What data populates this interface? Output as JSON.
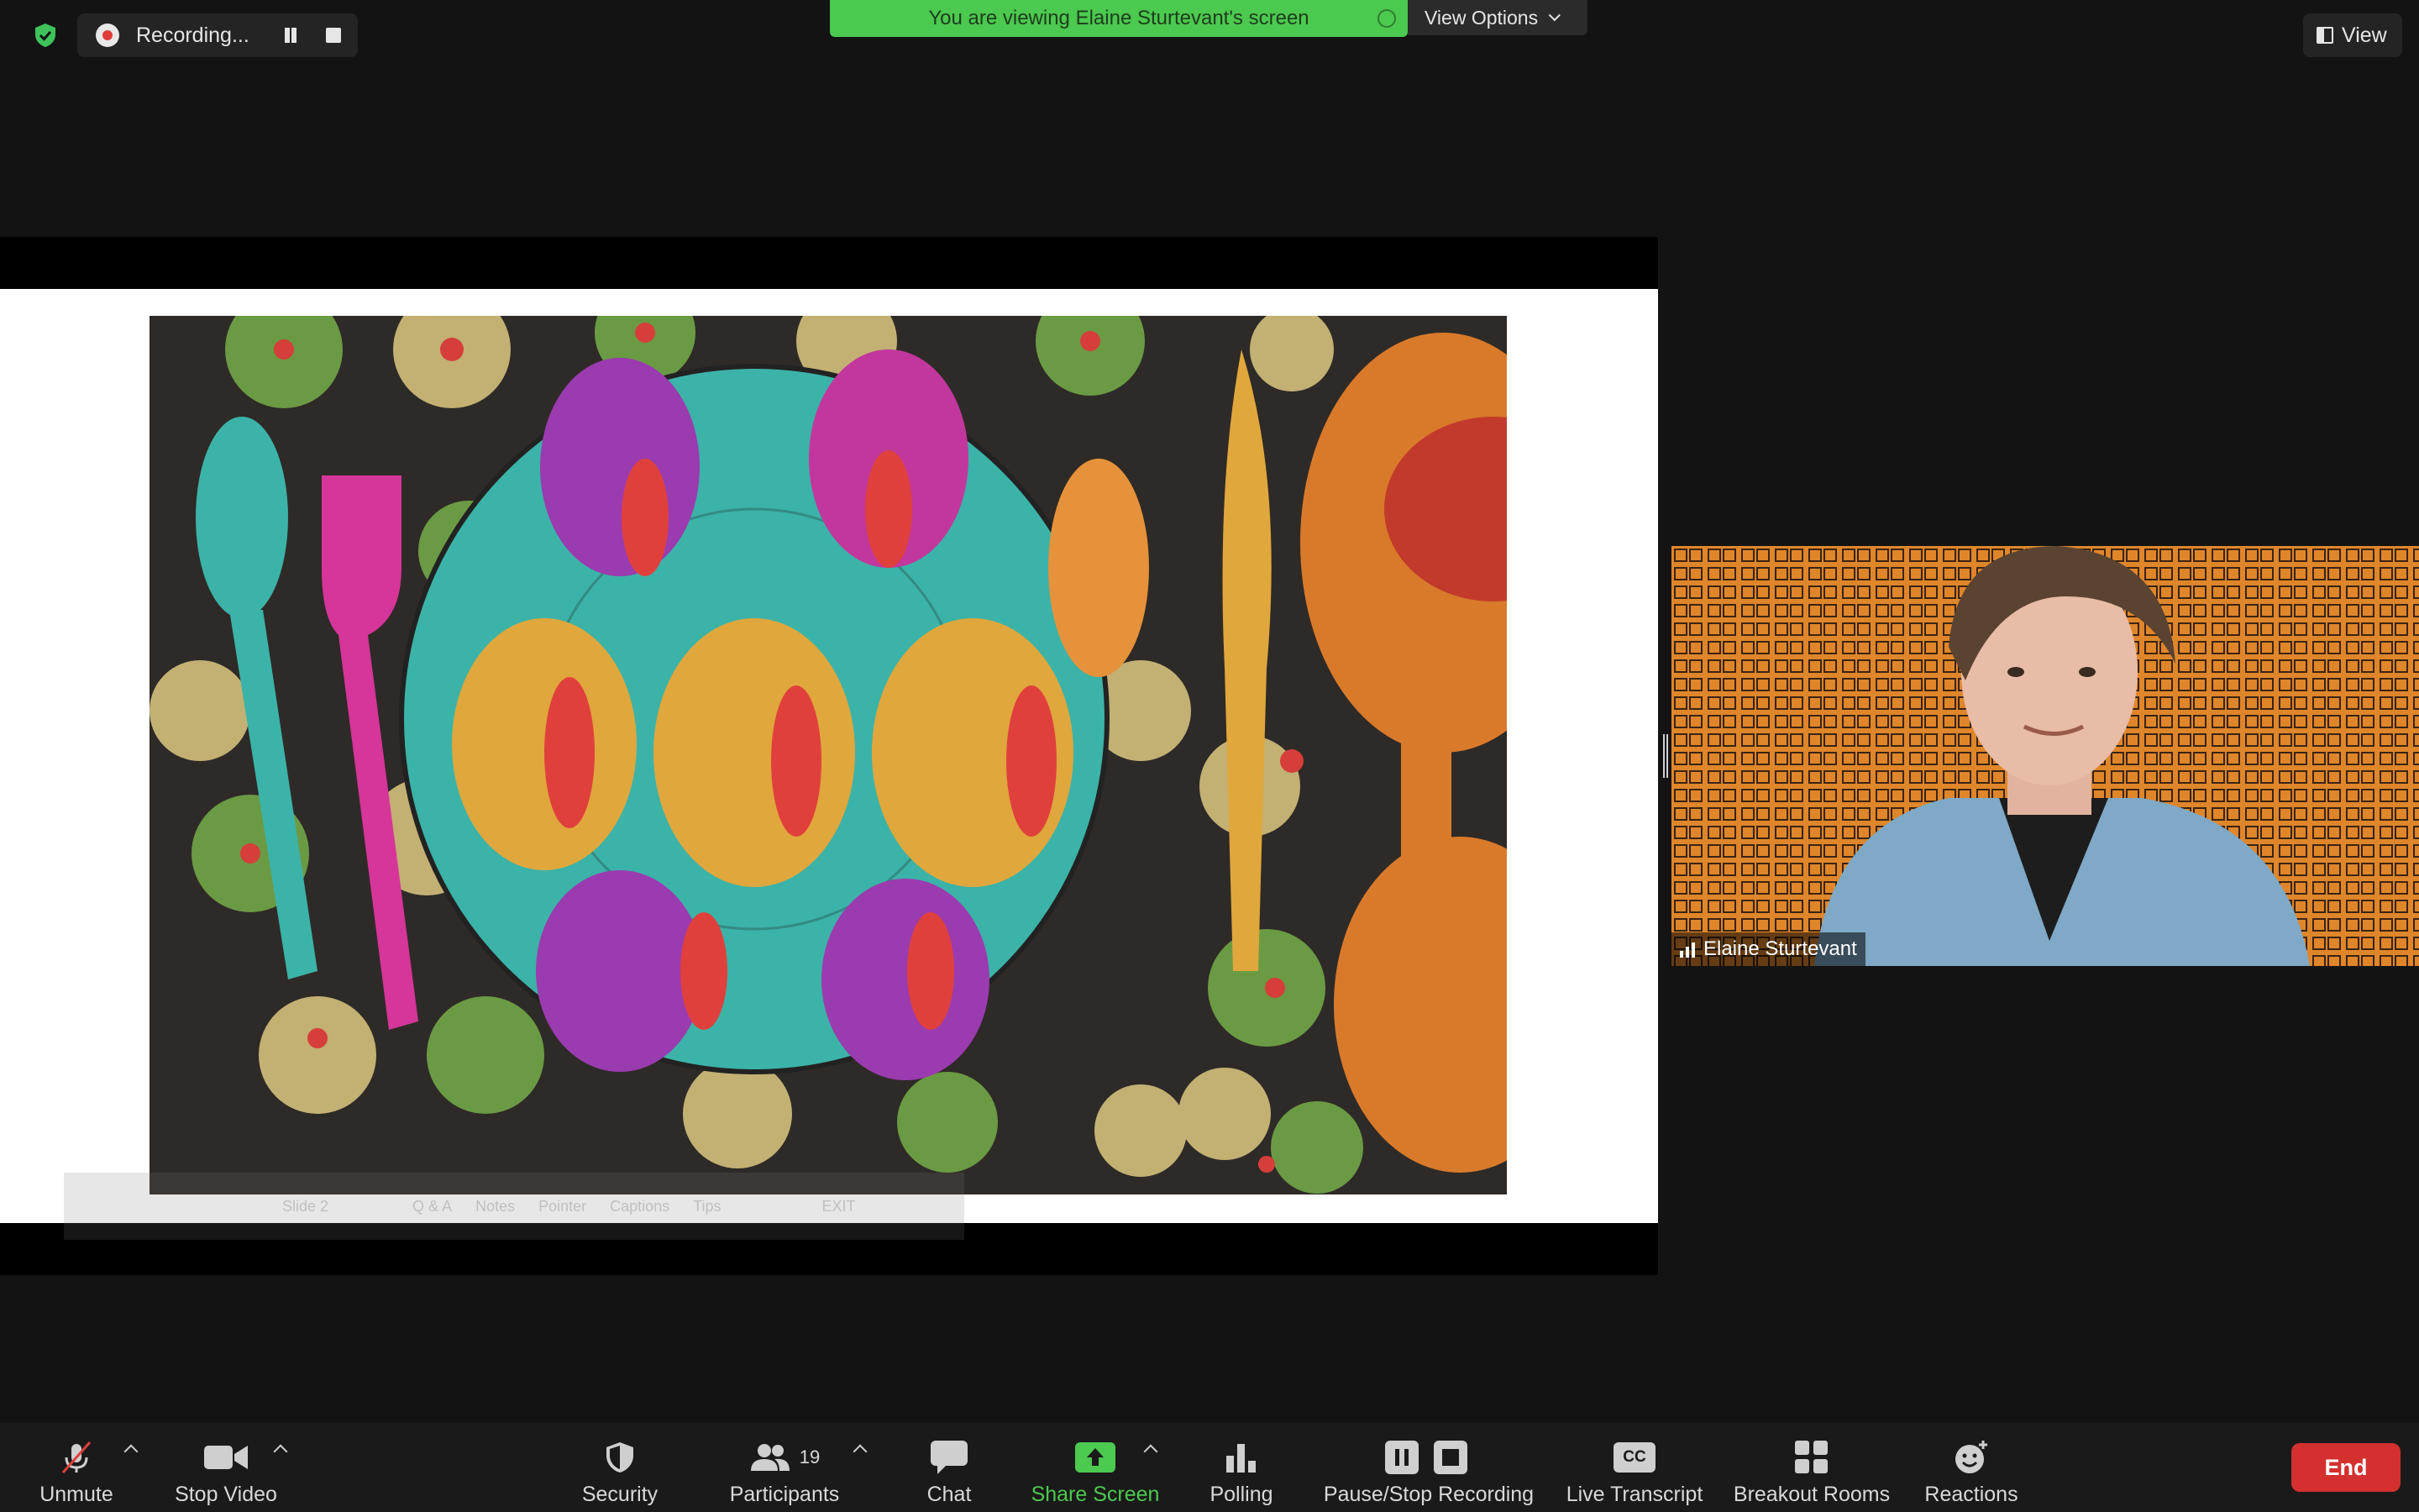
{
  "recording": {
    "status_label": "Recording...",
    "status_icon": "record-dot-icon",
    "pause_icon": "pause-icon",
    "stop_icon": "stop-icon"
  },
  "security_shield_icon": "shield-check-icon",
  "banner": {
    "viewing_text": "You are viewing Elaine Sturtevant's screen",
    "view_options_label": "View Options",
    "color": "#4cc94f"
  },
  "view_button": {
    "label": "View"
  },
  "shared_screen": {
    "slide_controls": [
      "Slide 2",
      "Q & A",
      "Notes",
      "Pointer",
      "Captions",
      "Tips",
      "EXIT"
    ]
  },
  "participant": {
    "name": "Elaine Sturtevant",
    "signal_icon": "signal-bars-icon"
  },
  "toolbar": {
    "unmute": "Unmute",
    "stop_video": "Stop Video",
    "security": "Security",
    "participants": "Participants",
    "participants_count": "19",
    "chat": "Chat",
    "share_screen": "Share Screen",
    "polling": "Polling",
    "pause_stop_recording": "Pause/Stop Recording",
    "live_transcript": "Live Transcript",
    "cc_badge": "CC",
    "breakout_rooms": "Breakout Rooms",
    "reactions": "Reactions",
    "end": "End",
    "end_color": "#d3302f",
    "share_color": "#4cc94f"
  }
}
